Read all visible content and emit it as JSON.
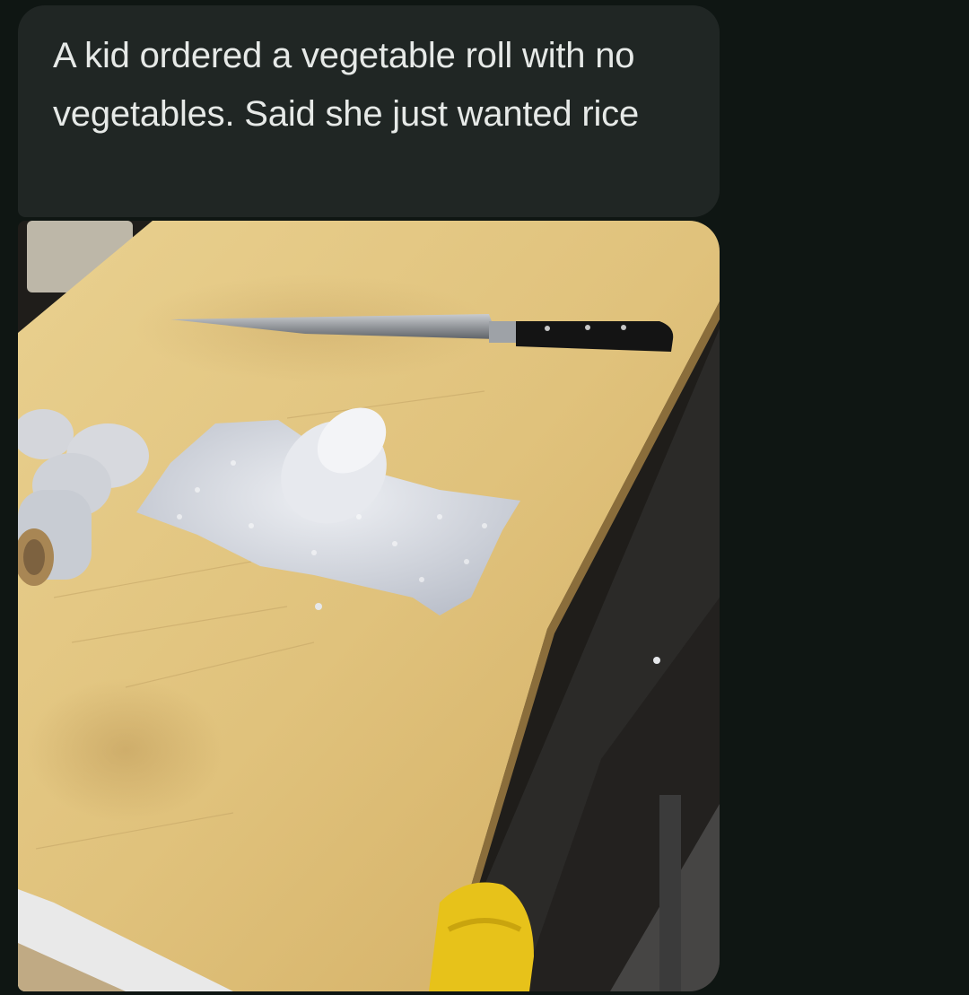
{
  "message": {
    "text": "A kid ordered a vegetable roll with no vegetables. Said she just wanted rice",
    "attachment": {
      "type": "photo",
      "icon": "photo-attachment"
    }
  },
  "colors": {
    "background": "#0f1613",
    "bubble": "#202624",
    "bubble_text": "#e6e9e7",
    "cutting_board": "#e2c682"
  }
}
